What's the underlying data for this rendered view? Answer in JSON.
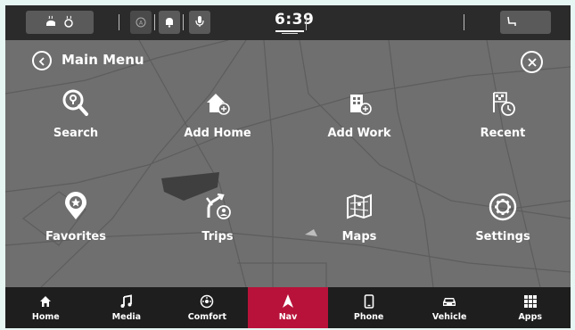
{
  "status_bar": {
    "time": "6:39",
    "left_pill_icons": [
      "heated-steering-wheel-icon",
      "heated-seat-icon"
    ],
    "indicator_icons": [
      "circle-indicator-icon",
      "bell-icon",
      "microphone-icon"
    ],
    "right_pill_icon": "heated-seat-passenger-icon"
  },
  "header": {
    "title": "Main Menu"
  },
  "menu": {
    "items": [
      {
        "label": "Search",
        "icon": "search-icon"
      },
      {
        "label": "Add Home",
        "icon": "add-home-icon"
      },
      {
        "label": "Add Work",
        "icon": "add-work-icon"
      },
      {
        "label": "Recent",
        "icon": "recent-icon"
      },
      {
        "label": "Favorites",
        "icon": "favorites-icon"
      },
      {
        "label": "Trips",
        "icon": "trips-icon"
      },
      {
        "label": "Maps",
        "icon": "maps-icon"
      },
      {
        "label": "Settings",
        "icon": "settings-icon"
      }
    ]
  },
  "nav_bar": {
    "active": "Nav",
    "active_color": "#b8123a",
    "items": [
      {
        "label": "Home",
        "icon": "home-icon"
      },
      {
        "label": "Media",
        "icon": "music-note-icon"
      },
      {
        "label": "Comfort",
        "icon": "comfort-icon"
      },
      {
        "label": "Nav",
        "icon": "navigation-arrow-icon"
      },
      {
        "label": "Phone",
        "icon": "phone-icon"
      },
      {
        "label": "Vehicle",
        "icon": "vehicle-icon"
      },
      {
        "label": "Apps",
        "icon": "apps-grid-icon"
      }
    ]
  }
}
